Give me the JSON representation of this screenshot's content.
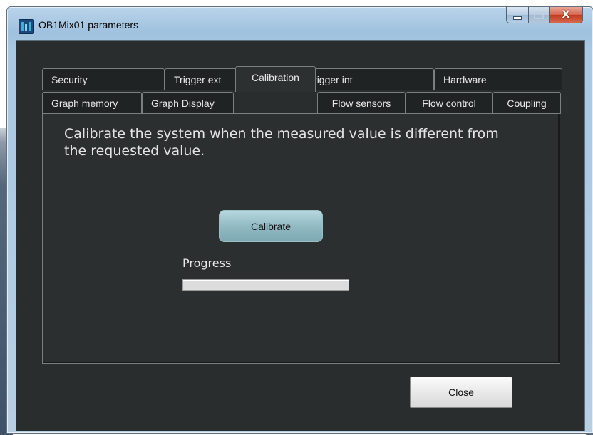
{
  "window": {
    "title": "OB1Mix01 parameters",
    "controls": {
      "minimize": "minimize-icon",
      "maximize": "maximize-icon",
      "close_glyph": "X"
    }
  },
  "tabs": {
    "row_back": [
      "Security",
      "Trigger ext",
      "Trigger int",
      "Hardware"
    ],
    "row_front": [
      "Graph memory",
      "Graph Display",
      "Calibration",
      "Flow sensors",
      "Flow control",
      "Coupling"
    ],
    "active": "Calibration"
  },
  "calibration": {
    "description": "Calibrate the system when the measured value is different from the requested value.",
    "calibrate_label": "Calibrate",
    "progress_label": "Progress",
    "progress_value": 0
  },
  "footer": {
    "close_label": "Close"
  },
  "colors": {
    "client_bg": "#2a2d2e",
    "calibrate_button": "#8fb8c1",
    "close_x": "#c23a20"
  }
}
